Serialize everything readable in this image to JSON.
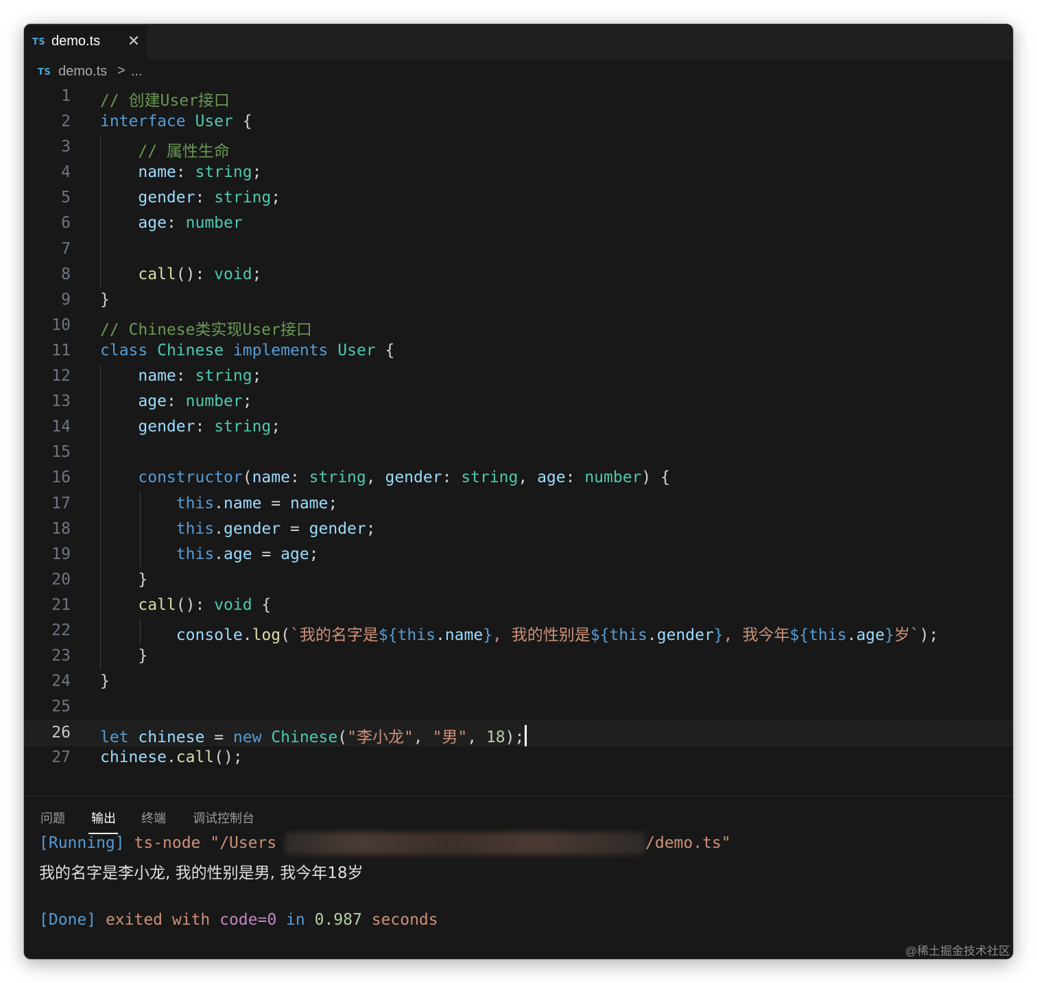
{
  "tab": {
    "badge": "TS",
    "filename": "demo.ts",
    "close_glyph": "✕"
  },
  "breadcrumb": {
    "badge": "TS",
    "file": "demo.ts",
    "separator": ">",
    "ellipsis": "..."
  },
  "code": [
    {
      "n": "1",
      "t": [
        [
          "// 创建User接口",
          "c"
        ]
      ]
    },
    {
      "n": "2",
      "t": [
        [
          "interface",
          "k"
        ],
        [
          " ",
          "p"
        ],
        [
          "User",
          "t"
        ],
        [
          " {",
          "p"
        ]
      ]
    },
    {
      "n": "3",
      "t": [
        [
          "    // 属性生命",
          "c"
        ]
      ]
    },
    {
      "n": "4",
      "t": [
        [
          "    ",
          "p"
        ],
        [
          "name",
          "v"
        ],
        [
          ": ",
          "p"
        ],
        [
          "string",
          "t"
        ],
        [
          ";",
          "p"
        ]
      ]
    },
    {
      "n": "5",
      "t": [
        [
          "    ",
          "p"
        ],
        [
          "gender",
          "v"
        ],
        [
          ": ",
          "p"
        ],
        [
          "string",
          "t"
        ],
        [
          ";",
          "p"
        ]
      ]
    },
    {
      "n": "6",
      "t": [
        [
          "    ",
          "p"
        ],
        [
          "age",
          "v"
        ],
        [
          ": ",
          "p"
        ],
        [
          "number",
          "t"
        ]
      ]
    },
    {
      "n": "7",
      "t": []
    },
    {
      "n": "8",
      "t": [
        [
          "    ",
          "p"
        ],
        [
          "call",
          "f"
        ],
        [
          "(): ",
          "p"
        ],
        [
          "void",
          "t"
        ],
        [
          ";",
          "p"
        ]
      ]
    },
    {
      "n": "9",
      "t": [
        [
          "}",
          "p"
        ]
      ]
    },
    {
      "n": "10",
      "t": [
        [
          "// Chinese类实现User接口",
          "c"
        ]
      ]
    },
    {
      "n": "11",
      "t": [
        [
          "class",
          "k"
        ],
        [
          " ",
          "p"
        ],
        [
          "Chinese",
          "t"
        ],
        [
          " ",
          "p"
        ],
        [
          "implements",
          "k"
        ],
        [
          " ",
          "p"
        ],
        [
          "User",
          "t"
        ],
        [
          " {",
          "p"
        ]
      ]
    },
    {
      "n": "12",
      "t": [
        [
          "    ",
          "p"
        ],
        [
          "name",
          "v"
        ],
        [
          ": ",
          "p"
        ],
        [
          "string",
          "t"
        ],
        [
          ";",
          "p"
        ]
      ]
    },
    {
      "n": "13",
      "t": [
        [
          "    ",
          "p"
        ],
        [
          "age",
          "v"
        ],
        [
          ": ",
          "p"
        ],
        [
          "number",
          "t"
        ],
        [
          ";",
          "p"
        ]
      ]
    },
    {
      "n": "14",
      "t": [
        [
          "    ",
          "p"
        ],
        [
          "gender",
          "v"
        ],
        [
          ": ",
          "p"
        ],
        [
          "string",
          "t"
        ],
        [
          ";",
          "p"
        ]
      ]
    },
    {
      "n": "15",
      "t": []
    },
    {
      "n": "16",
      "t": [
        [
          "    ",
          "p"
        ],
        [
          "constructor",
          "k"
        ],
        [
          "(",
          "p"
        ],
        [
          "name",
          "v"
        ],
        [
          ": ",
          "p"
        ],
        [
          "string",
          "t"
        ],
        [
          ", ",
          "p"
        ],
        [
          "gender",
          "v"
        ],
        [
          ": ",
          "p"
        ],
        [
          "string",
          "t"
        ],
        [
          ", ",
          "p"
        ],
        [
          "age",
          "v"
        ],
        [
          ": ",
          "p"
        ],
        [
          "number",
          "t"
        ],
        [
          ") {",
          "p"
        ]
      ]
    },
    {
      "n": "17",
      "t": [
        [
          "        ",
          "p"
        ],
        [
          "this",
          "k"
        ],
        [
          ".",
          "p"
        ],
        [
          "name",
          "v"
        ],
        [
          " = ",
          "p"
        ],
        [
          "name",
          "v"
        ],
        [
          ";",
          "p"
        ]
      ]
    },
    {
      "n": "18",
      "t": [
        [
          "        ",
          "p"
        ],
        [
          "this",
          "k"
        ],
        [
          ".",
          "p"
        ],
        [
          "gender",
          "v"
        ],
        [
          " = ",
          "p"
        ],
        [
          "gender",
          "v"
        ],
        [
          ";",
          "p"
        ]
      ]
    },
    {
      "n": "19",
      "t": [
        [
          "        ",
          "p"
        ],
        [
          "this",
          "k"
        ],
        [
          ".",
          "p"
        ],
        [
          "age",
          "v"
        ],
        [
          " = ",
          "p"
        ],
        [
          "age",
          "v"
        ],
        [
          ";",
          "p"
        ]
      ]
    },
    {
      "n": "20",
      "t": [
        [
          "    }",
          "p"
        ]
      ]
    },
    {
      "n": "21",
      "t": [
        [
          "    ",
          "p"
        ],
        [
          "call",
          "f"
        ],
        [
          "(): ",
          "p"
        ],
        [
          "void",
          "t"
        ],
        [
          " {",
          "p"
        ]
      ]
    },
    {
      "n": "22",
      "t": [
        [
          "        ",
          "p"
        ],
        [
          "console",
          "v"
        ],
        [
          ".",
          "p"
        ],
        [
          "log",
          "f"
        ],
        [
          "(",
          "p"
        ],
        [
          "`我的名字是",
          "s"
        ],
        [
          "${",
          "k"
        ],
        [
          "this",
          "k"
        ],
        [
          ".",
          "p"
        ],
        [
          "name",
          "v"
        ],
        [
          "}",
          "k"
        ],
        [
          ", 我的性别是",
          "s"
        ],
        [
          "${",
          "k"
        ],
        [
          "this",
          "k"
        ],
        [
          ".",
          "p"
        ],
        [
          "gender",
          "v"
        ],
        [
          "}",
          "k"
        ],
        [
          ", 我今年",
          "s"
        ],
        [
          "${",
          "k"
        ],
        [
          "this",
          "k"
        ],
        [
          ".",
          "p"
        ],
        [
          "age",
          "v"
        ],
        [
          "}",
          "k"
        ],
        [
          "岁`",
          "s"
        ],
        [
          ");",
          "p"
        ]
      ]
    },
    {
      "n": "23",
      "t": [
        [
          "    }",
          "p"
        ]
      ]
    },
    {
      "n": "24",
      "t": [
        [
          "}",
          "p"
        ]
      ]
    },
    {
      "n": "25",
      "t": []
    },
    {
      "n": "26",
      "t": [
        [
          "let",
          "k"
        ],
        [
          " ",
          "p"
        ],
        [
          "chinese",
          "v"
        ],
        [
          " = ",
          "p"
        ],
        [
          "new",
          "k"
        ],
        [
          " ",
          "p"
        ],
        [
          "Chinese",
          "t"
        ],
        [
          "(",
          "p"
        ],
        [
          "\"李小龙\"",
          "s"
        ],
        [
          ", ",
          "p"
        ],
        [
          "\"男\"",
          "s"
        ],
        [
          ", ",
          "p"
        ],
        [
          "18",
          "n"
        ],
        [
          ");",
          "p"
        ]
      ],
      "current": true
    },
    {
      "n": "27",
      "t": [
        [
          "chinese",
          "v"
        ],
        [
          ".",
          "p"
        ],
        [
          "call",
          "f"
        ],
        [
          "();",
          "p"
        ]
      ]
    }
  ],
  "panel": {
    "tabs": [
      "问题",
      "输出",
      "终端",
      "调试控制台"
    ],
    "active_tab": "输出",
    "running_tag": "[Running]",
    "running_cmd": " ts-node \"/Users",
    "running_tail": "/demo.ts\"",
    "output_line": "我的名字是李小龙, 我的性别是男, 我今年18岁",
    "done_tag": "[Done]",
    "done_exited": " exited with ",
    "done_code": "code=0",
    "done_in": " in ",
    "done_seconds_value": "0.987",
    "done_seconds": " seconds"
  },
  "watermark": "@稀土掘金技术社区"
}
